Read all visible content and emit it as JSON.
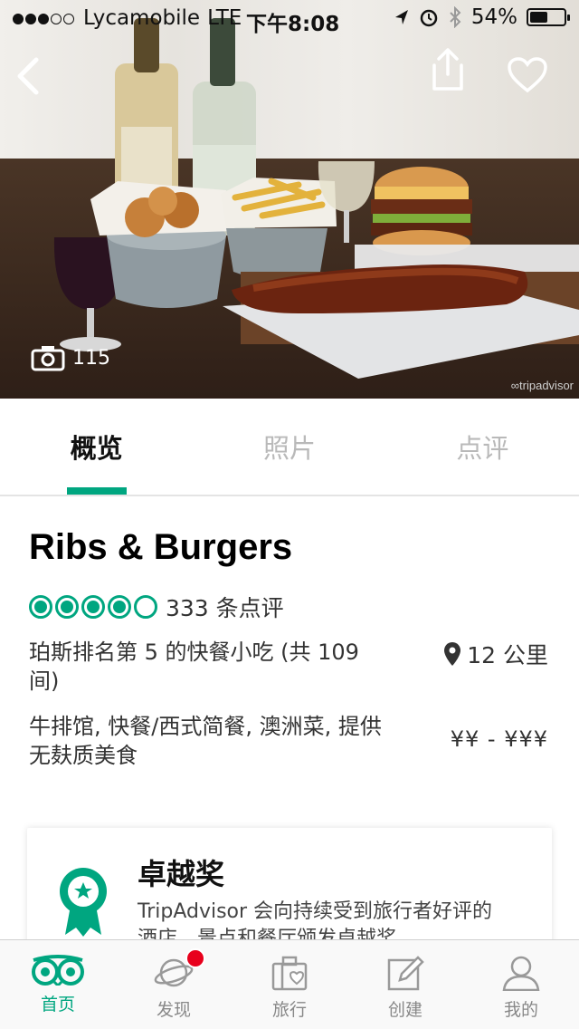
{
  "status_bar": {
    "carrier": "Lycamobile",
    "network": "LTE",
    "time": "下午8:08",
    "battery_percent": "54%",
    "battery_level": 0.54,
    "signal_bars_filled": 3,
    "signal_bars_total": 5
  },
  "hero": {
    "photo_count": "115",
    "watermark": "tripadvisor",
    "back_icon": "chevron-left-icon",
    "share_icon": "share-icon",
    "favorite_icon": "heart-icon"
  },
  "tabs": [
    {
      "label": "概览",
      "active": true
    },
    {
      "label": "照片",
      "active": false
    },
    {
      "label": "点评",
      "active": false
    }
  ],
  "restaurant": {
    "name": "Ribs & Burgers",
    "rating": 4,
    "rating_max": 5,
    "reviews": "333 条点评",
    "rank": "珀斯排名第 5 的快餐小吃 (共 109 间)",
    "distance": "12 公里",
    "cuisine": "牛排馆, 快餐/西式简餐, 澳洲菜, 提供无麸质美食",
    "price": "¥¥ - ¥¥¥"
  },
  "award": {
    "title": "卓越奖",
    "description": "TripAdvisor 会向持续受到旅行者好评的酒店、景点和餐厅颁发卓越奖。"
  },
  "bottom_nav": [
    {
      "label": "首页",
      "icon": "tripadvisor-owl-icon",
      "active": true
    },
    {
      "label": "发现",
      "icon": "planet-icon",
      "active": false,
      "badge": true
    },
    {
      "label": "旅行",
      "icon": "suitcase-heart-icon",
      "active": false
    },
    {
      "label": "创建",
      "icon": "edit-icon",
      "active": false
    },
    {
      "label": "我的",
      "icon": "profile-icon",
      "active": false
    }
  ],
  "colors": {
    "accent": "#00a680",
    "badge": "#e8001c"
  }
}
